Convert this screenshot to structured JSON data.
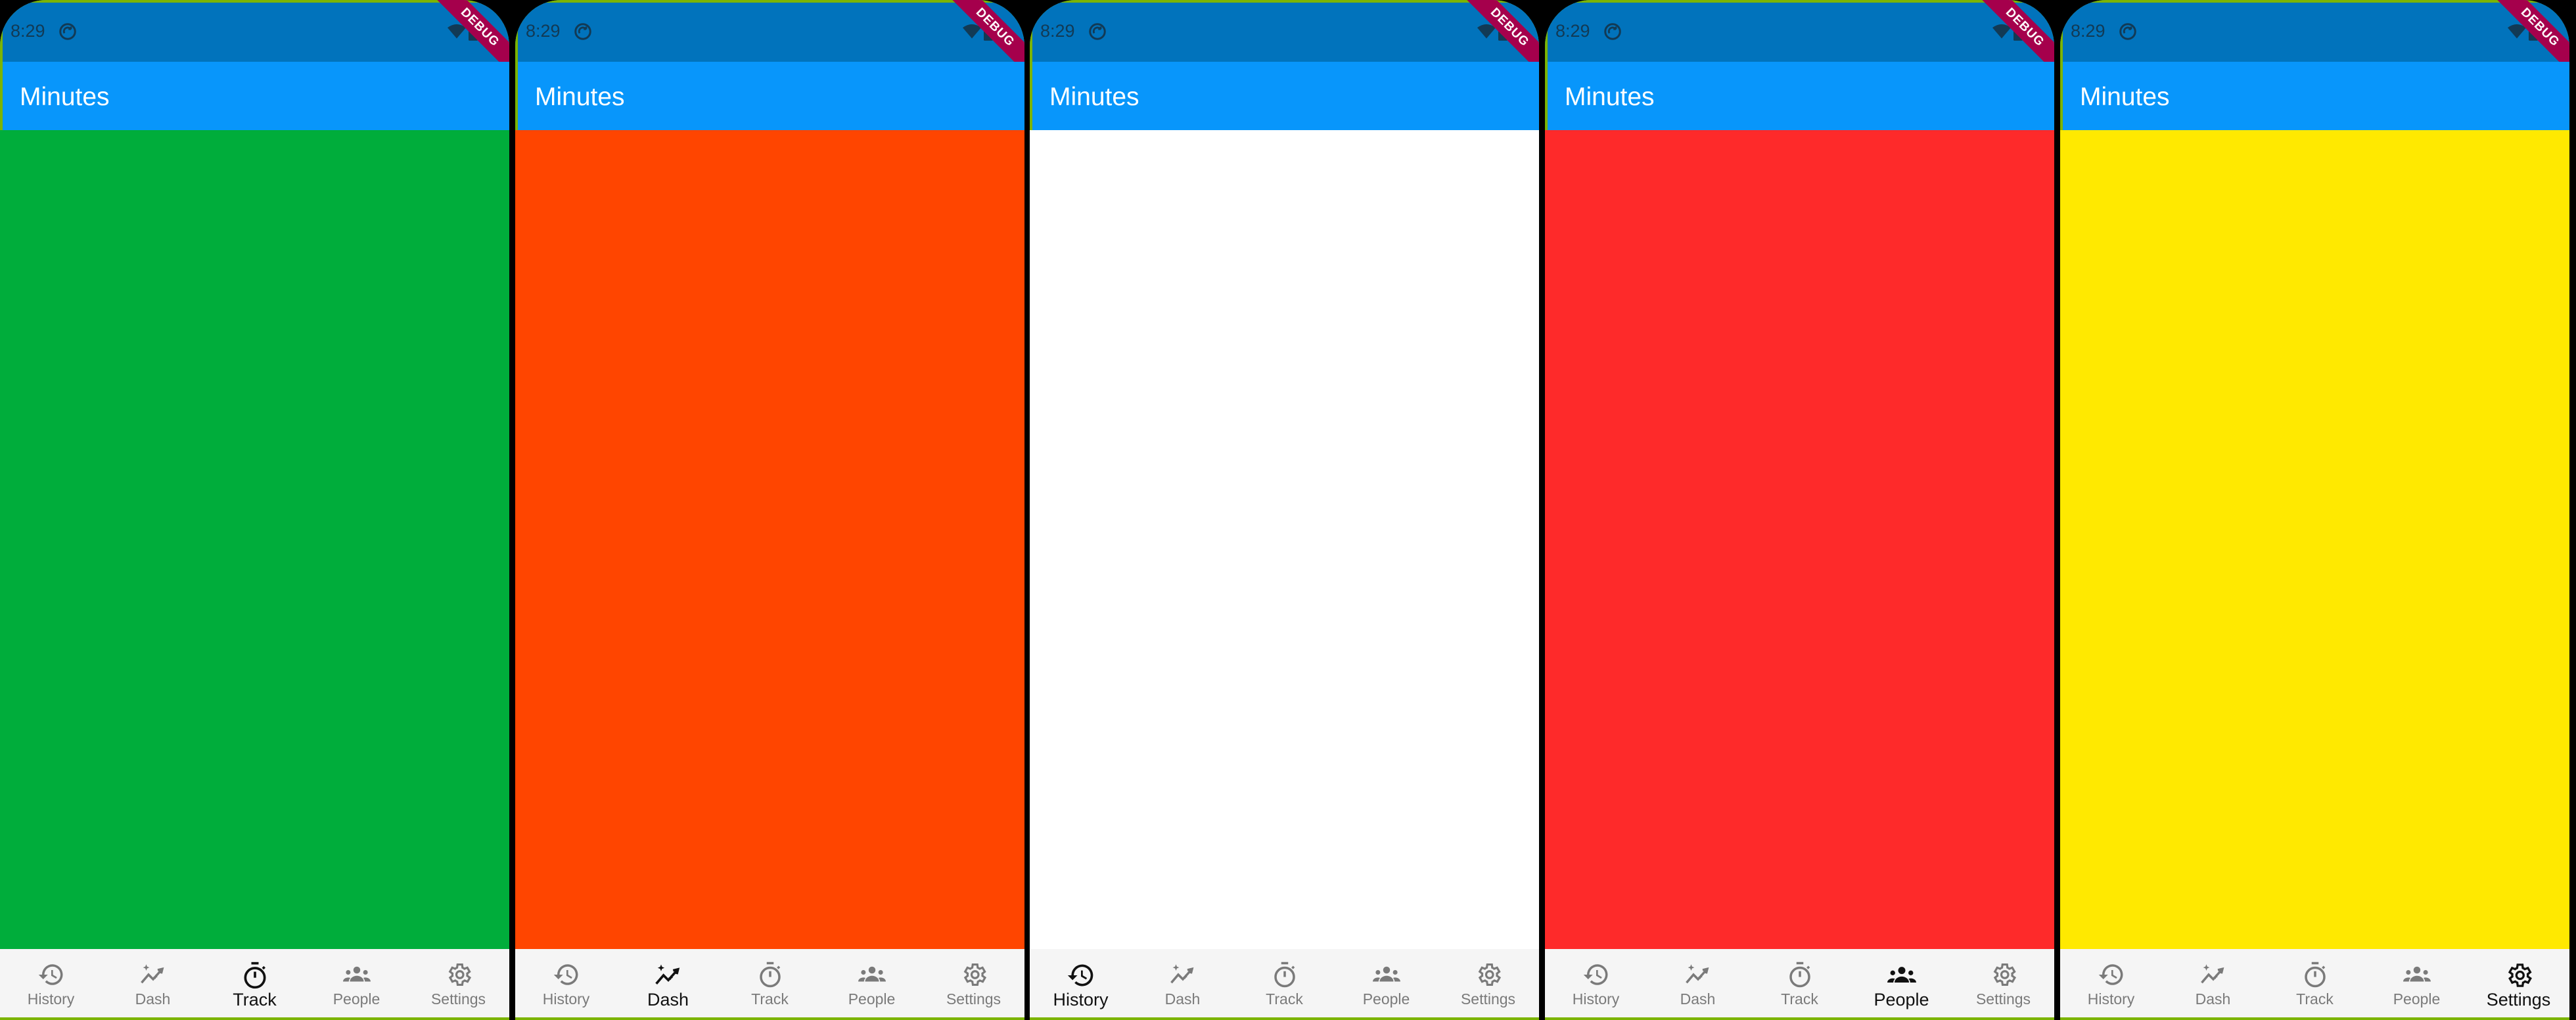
{
  "status": {
    "time": "8:29",
    "debug_banner": "DEBUG"
  },
  "app": {
    "title": "Minutes"
  },
  "nav_items": [
    {
      "label": "History",
      "icon": "history-icon"
    },
    {
      "label": "Dash",
      "icon": "auto-graph-icon"
    },
    {
      "label": "Track",
      "icon": "timer-icon"
    },
    {
      "label": "People",
      "icon": "groups-icon"
    },
    {
      "label": "Settings",
      "icon": "gear-icon"
    }
  ],
  "screens": [
    {
      "content_color": "#00ad3b",
      "active_tab": "Track"
    },
    {
      "content_color": "#ff4500",
      "active_tab": "Dash"
    },
    {
      "content_color": "#ffffff",
      "active_tab": "History"
    },
    {
      "content_color": "#fe2a2a",
      "active_tab": "People"
    },
    {
      "content_color": "#ffe900",
      "active_tab": "Settings"
    }
  ],
  "colors": {
    "status_bar": "#0173bc",
    "app_bar": "#0896fb",
    "nav_bg": "#f5f5f5",
    "nav_active": "#111111",
    "nav_inactive": "#7a7a7a"
  }
}
